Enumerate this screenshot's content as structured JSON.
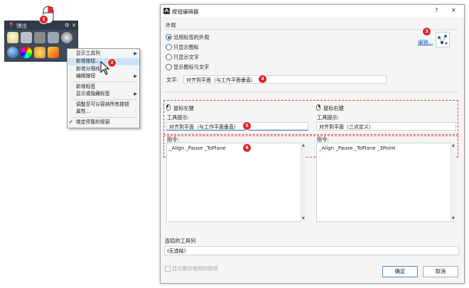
{
  "toolbar": {
    "title": "弹出",
    "icons": [
      "lightbulb-icon",
      "lock-icon",
      "save-icon",
      "zoom-window-icon",
      "viewport-icon",
      "render-sphere-icon",
      "color-wheel-icon",
      "sun-icon",
      "analysis-icon"
    ]
  },
  "context_menu": {
    "items": [
      {
        "label": "显示工具列",
        "submenu": true
      },
      {
        "label": "新增按钮...",
        "highlighted": true
      },
      {
        "label": "新增分隔线"
      },
      {
        "label": "编辑按钮",
        "submenu": true
      },
      {
        "label": "新增标签"
      },
      {
        "label": "显示或隐藏标签",
        "submenu": true
      },
      {
        "label": "调整至可以容纳所有按钮"
      },
      {
        "label": "属性..."
      },
      {
        "label": "锁定停靠的视窗",
        "checked": true
      }
    ]
  },
  "badges": [
    "1",
    "2",
    "3",
    "4",
    "5",
    "6"
  ],
  "dialog": {
    "title": "按钮编辑器",
    "help": "?",
    "close": "✕",
    "appearance_group": "外观",
    "appearance_options": [
      "沿用标签的外观",
      "只显示图标",
      "只显示文字",
      "显示图标与文字"
    ],
    "appearance_selected": 0,
    "edit_link": "编辑...",
    "text_label": "文字:",
    "text_value": "对齐到平面（与工作平面垂直）",
    "left_section": {
      "title": "鼠标左键",
      "tooltip_label": "工具提示:",
      "tooltip_value": "对齐到平面（与工作平面垂直）",
      "command_label": "指令:",
      "command_value": "_Align _Pause _ToPlane"
    },
    "right_section": {
      "title": "鼠标右键",
      "tooltip_label": "工具提示:",
      "tooltip_value": "对齐到平面（三点定义）",
      "command_label": "指令:",
      "command_value": "_Align _Pause _ToPlane _3Point"
    },
    "linked_toolbar_label": "连结的工具列",
    "linked_toolbar_value": "(无连结)",
    "show_last_label": "显示最后使用的按钮",
    "ok": "确定",
    "cancel": "取消"
  },
  "colors": {
    "badge": "#e0242a",
    "dashed": "#e04040",
    "link": "#1f5fbf",
    "highlight": "#cde3f7"
  }
}
